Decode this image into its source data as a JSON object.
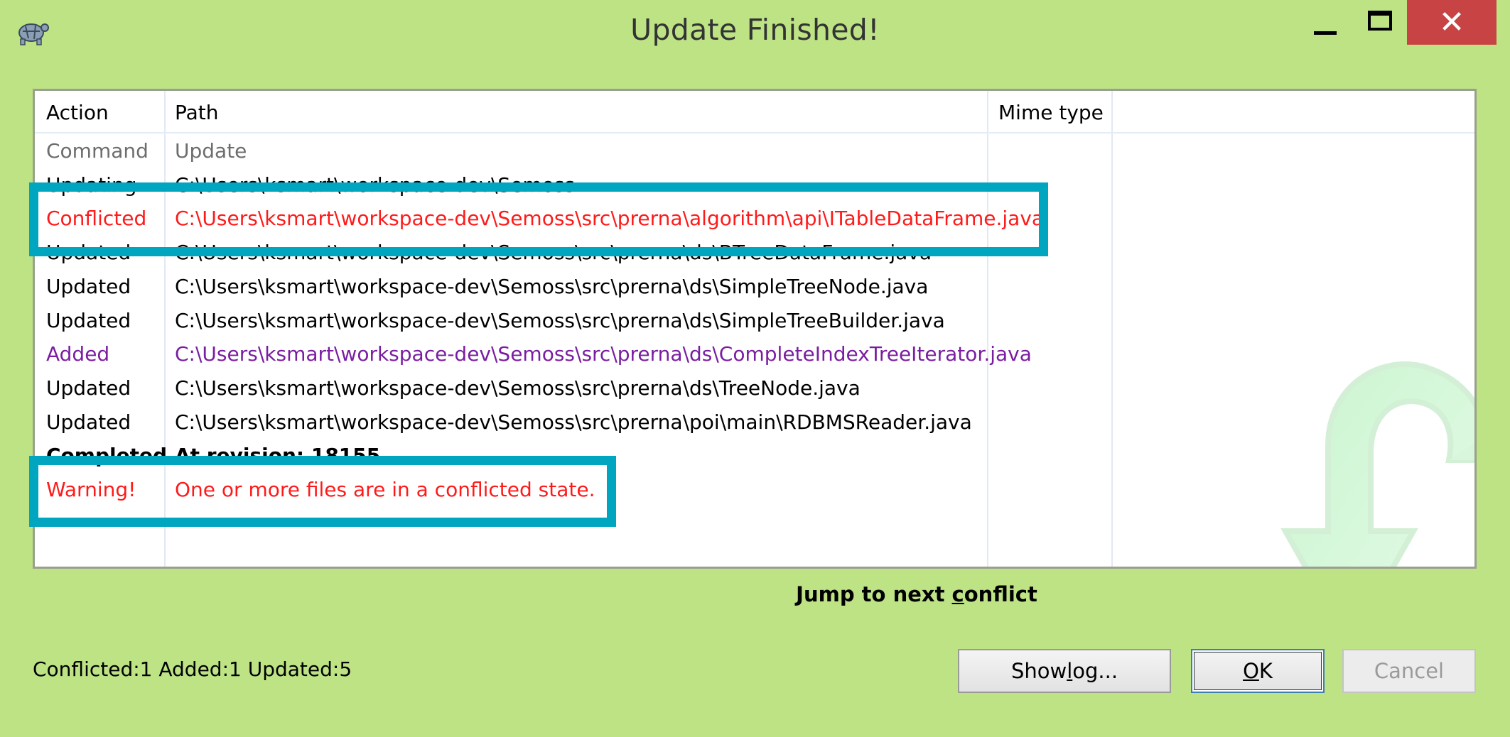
{
  "window": {
    "title": "Update Finished!",
    "close_glyph": "✕"
  },
  "table": {
    "headers": [
      "Action",
      "Path",
      "Mime type"
    ],
    "rows": [
      {
        "action": "Command",
        "path": "Update",
        "color": "#6d6d6d"
      },
      {
        "action": "Updating",
        "path": "C:\\Users\\ksmart\\workspace-dev\\Semoss",
        "color": "#000000"
      },
      {
        "action": "Conflicted",
        "path": "C:\\Users\\ksmart\\workspace-dev\\Semoss\\src\\prerna\\algorithm\\api\\ITableDataFrame.java",
        "color": "#ff1a1a"
      },
      {
        "action": "Updated",
        "path": "C:\\Users\\ksmart\\workspace-dev\\Semoss\\src\\prerna\\ds\\BTreeDataFrame.java",
        "color": "#000000"
      },
      {
        "action": "Updated",
        "path": "C:\\Users\\ksmart\\workspace-dev\\Semoss\\src\\prerna\\ds\\SimpleTreeNode.java",
        "color": "#000000"
      },
      {
        "action": "Updated",
        "path": "C:\\Users\\ksmart\\workspace-dev\\Semoss\\src\\prerna\\ds\\SimpleTreeBuilder.java",
        "color": "#000000"
      },
      {
        "action": "Added",
        "path": "C:\\Users\\ksmart\\workspace-dev\\Semoss\\src\\prerna\\ds\\CompleteIndexTreeIterator.java",
        "color": "#7a1ea1"
      },
      {
        "action": "Updated",
        "path": "C:\\Users\\ksmart\\workspace-dev\\Semoss\\src\\prerna\\ds\\TreeNode.java",
        "color": "#000000"
      },
      {
        "action": "Updated",
        "path": "C:\\Users\\ksmart\\workspace-dev\\Semoss\\src\\prerna\\poi\\main\\RDBMSReader.java",
        "color": "#000000"
      },
      {
        "action": "Completed",
        "path": "At revision: 18155",
        "color": "#000000"
      },
      {
        "action": "Warning!",
        "path": "One or more files are in a conflicted state.",
        "color": "#ff1a1a"
      }
    ]
  },
  "jump_link": {
    "before": "Jump to next ",
    "accel": "c",
    "after": "onflict"
  },
  "status_text": "Conflicted:1 Added:1 Updated:5",
  "buttons": {
    "show_log": {
      "before": "Show ",
      "accel": "l",
      "after": "og..."
    },
    "ok": {
      "accel": "O",
      "after": "K"
    },
    "cancel": "Cancel"
  },
  "colors": {
    "background": "#bde385",
    "highlight": "#00a5bf",
    "conflict": "#ff1a1a",
    "added": "#7a1ea1"
  }
}
